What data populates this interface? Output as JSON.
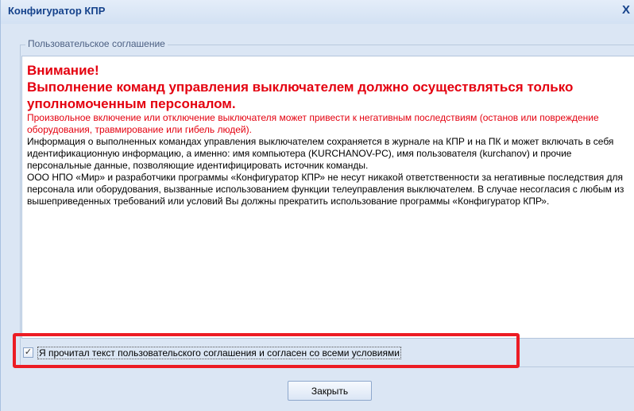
{
  "window": {
    "title": "Конфигуратор КПР",
    "close_glyph": "X"
  },
  "agreement": {
    "legend": "Пользовательское соглашение",
    "warning_title": "Внимание!",
    "warning_subtitle": "Выполнение команд управления выключателем должно осуществляться только уполномоченным персоналом.",
    "warning_text": "Произвольное включение или отключение выключателя может привести к негативным последствиям (останов или повреждение оборудования, травмирование или гибель людей).",
    "info_text_1": "Информация о выполненных командах управления выключателем сохраняется в журнале на КПР и на ПК и может включать в себя идентификационную информацию, а именно: имя компьютера (KURCHANOV-PC), имя пользователя (kurchanov) и прочие персональные данные, позволяющие идентифицировать источник команды.",
    "info_text_2": "ООО НПО «Мир» и разработчики программы «Конфигуратор КПР» не несут никакой ответственности за негативные последствия для персонала или оборудования, вызванные использованием функции телеуправления выключателем. В случае несогласия с любым из вышеприведенных требований или условий Вы должны прекратить использование программы «Конфигуратор КПР»."
  },
  "consent": {
    "checked": true,
    "check_glyph": "✓",
    "label": "Я прочитал текст пользовательского соглашения и согласен со всеми условиями"
  },
  "buttons": {
    "close_label": "Закрыть"
  },
  "colors": {
    "warning": "#e4000f",
    "title": "#15428b",
    "highlight": "#ec1c24"
  }
}
